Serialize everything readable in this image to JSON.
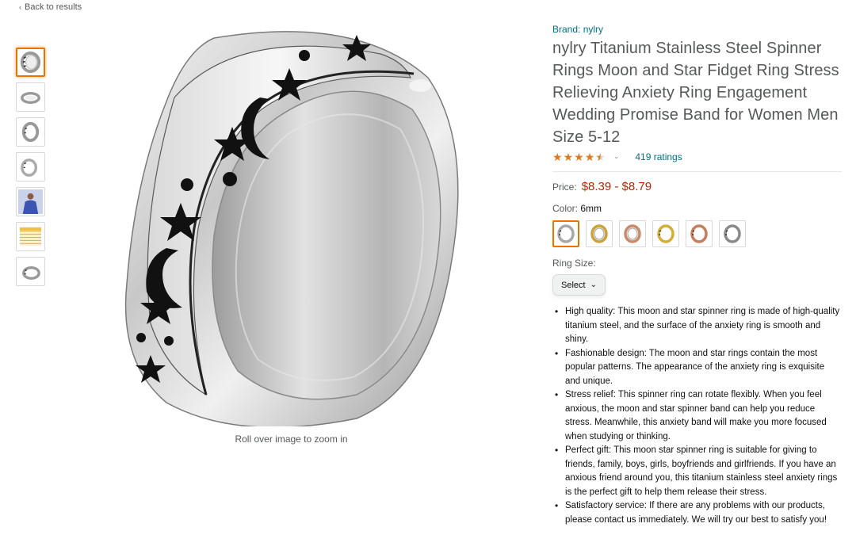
{
  "nav": {
    "back_label": "Back to results"
  },
  "gallery": {
    "thumbnails": [
      {
        "name": "ring-front",
        "selected": true
      },
      {
        "name": "ring-side"
      },
      {
        "name": "ring-angle"
      },
      {
        "name": "ring-detail"
      },
      {
        "name": "model-wearing"
      },
      {
        "name": "size-chart"
      },
      {
        "name": "ring-inner"
      }
    ],
    "zoom_hint": "Roll over image to zoom in"
  },
  "product": {
    "brand": "Brand: nylry",
    "title": "nylry Titanium Stainless Steel Spinner Rings Moon and Star Fidget Ring Stress Relieving Anxiety Ring Engagement Wedding Promise Band for Women Men Size 5-12",
    "rating_stars": 4.5,
    "ratings_count": "419 ratings",
    "price_label": "Price:",
    "price_value": "$8.39 - $8.79",
    "color_label": "Color:",
    "color_value": "6mm",
    "colors": [
      {
        "name": "silver",
        "hex": "#b8b8b8",
        "selected": true
      },
      {
        "name": "gold-silver",
        "hex": "#d4af37"
      },
      {
        "name": "rose-gold-silver",
        "hex": "#c98a6a"
      },
      {
        "name": "gold",
        "hex": "#d4af37"
      },
      {
        "name": "rose-gold",
        "hex": "#c98a6a"
      },
      {
        "name": "silver-black",
        "hex": "#9a9a9a"
      }
    ],
    "size_label": "Ring Size:",
    "size_select": "Select",
    "bullets": [
      "High quality: This moon and star spinner ring is made of high-quality titanium steel, and the surface of the anxiety ring is smooth and shiny.",
      "Fashionable design: The moon and star rings contain the most popular patterns. The appearance of the anxiety ring is exquisite and unique.",
      "Stress relief: This spinner ring can rotate flexibly. When you feel anxious, the moon and star spinner band can help you reduce stress. Meanwhile, this anxiety band will make you more focused when studying or thinking.",
      "Perfect gift: This moon star spinner ring is suitable for giving to friends, family, boys, girls, boyfriends and girlfriends. If you have an anxious friend around you, this titanium stainless steel anxiety rings is the perfect gift to help them release their stress.",
      "Satisfactory service: If there are any problems with our products, please contact us immediately. We will try our best to satisfy you!"
    ]
  },
  "colors": {
    "accent": "#e77600",
    "link": "#007185",
    "price": "#b12704",
    "star": "#de7921"
  }
}
